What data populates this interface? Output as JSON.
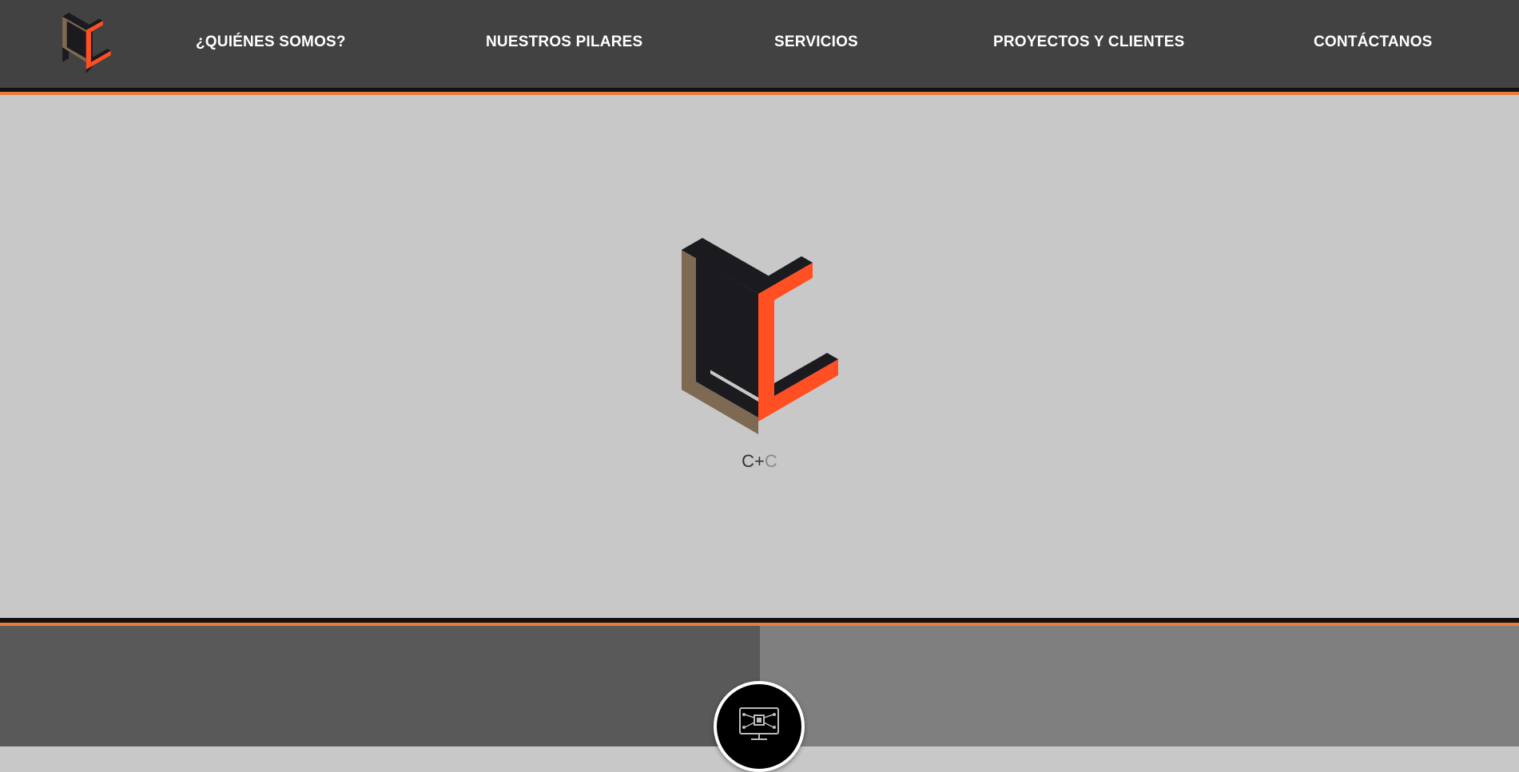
{
  "header": {
    "logo_icon": "cc-logo-icon",
    "nav": [
      {
        "label": "¿QUIÉNES SOMOS?"
      },
      {
        "label": "NUESTROS PILARES"
      },
      {
        "label": "SERVICIOS"
      },
      {
        "label": "PROYECTOS Y CLIENTES"
      },
      {
        "label": "CONTÁCTANOS"
      }
    ]
  },
  "hero": {
    "logo_icon": "cc-logo-icon",
    "caption_first": "C+",
    "caption_second": "C"
  },
  "services": {
    "icon": "computer-circuit-icon"
  },
  "colors": {
    "header_bg": "#424242",
    "accent_orange": "#ea7b38",
    "logo_orange": "#ff4f23",
    "logo_brown": "#7e6a52",
    "logo_dark": "#1b1a1f",
    "hero_bg": "#c8c8c8",
    "panel_left": "#595959",
    "panel_right": "#7f7f7f"
  }
}
